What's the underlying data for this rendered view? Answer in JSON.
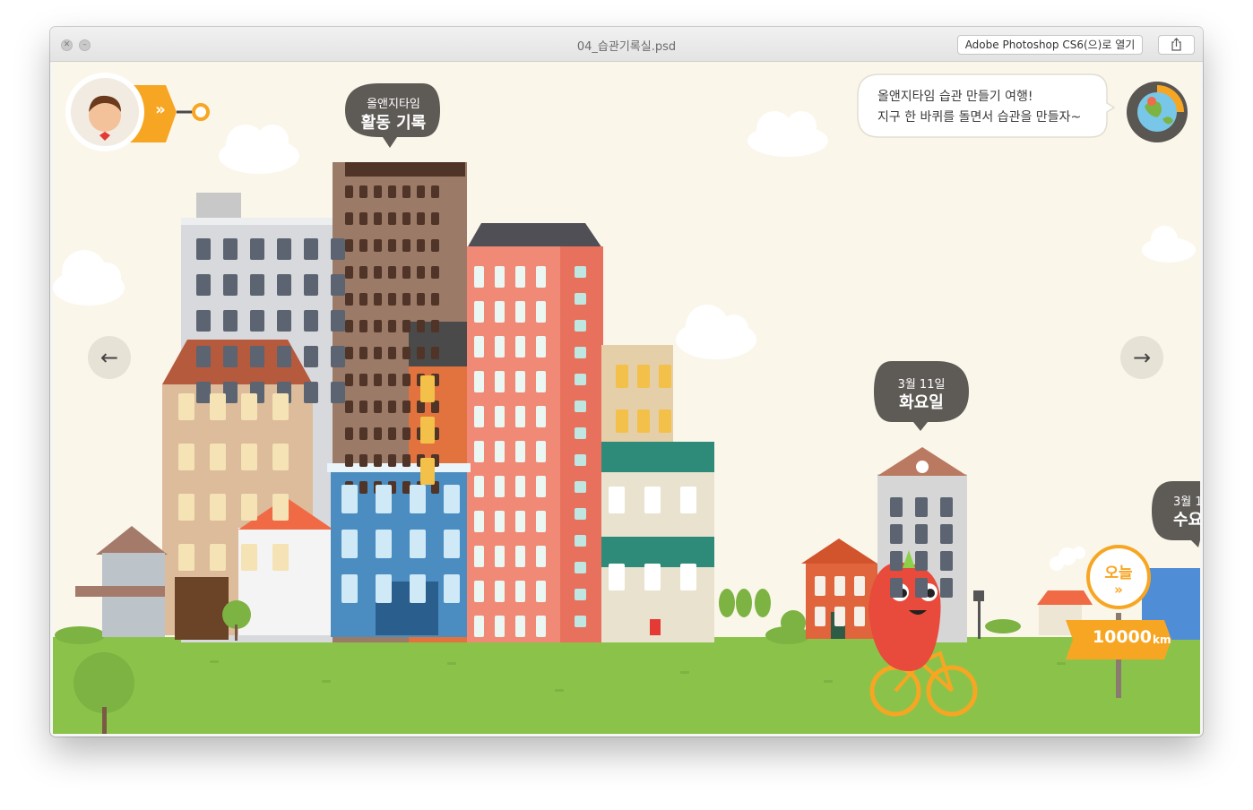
{
  "window": {
    "title": "04_습관기록실.psd",
    "open_with_label": "Adobe Photoshop CS6(으)로 열기",
    "close_glyph": "✕",
    "minimize_glyph": "–"
  },
  "header": {
    "record_bubble": {
      "line1": "올앤지타임",
      "line2": "활동 기록"
    },
    "speech_bubble": {
      "line1": "올앤지타임 습관 만들기 여행!",
      "line2": "지구 한 바퀴를 돌면서 습관을 만들자~"
    }
  },
  "navigation": {
    "prev_arrow": "←",
    "next_arrow": "→",
    "expand_chevron": "»"
  },
  "date_bubbles": [
    {
      "line1": "3월 11일",
      "line2": "화요일"
    },
    {
      "line1": "3월 1",
      "line2": "수요"
    }
  ],
  "today_sign": {
    "label": "오늘",
    "chevron": "»"
  },
  "distance": {
    "value": "10000",
    "unit": "km"
  },
  "colors": {
    "sky": "#fbf6ea",
    "grass": "#8bc34a",
    "accent_orange": "#f7a623",
    "bubble_gray": "#5e5b57"
  },
  "icons": [
    "avatar-icon",
    "earth-icon",
    "share-icon",
    "close-icon",
    "minimize-icon"
  ]
}
